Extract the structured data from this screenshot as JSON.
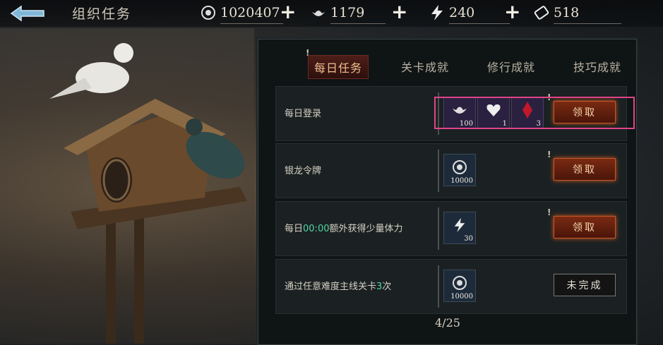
{
  "header": {
    "title": "组织任务",
    "resources": [
      {
        "icon": "coin-icon",
        "value": "1020407"
      },
      {
        "icon": "silver-ingot-icon",
        "value": "1179"
      },
      {
        "icon": "lightning-icon",
        "value": "240"
      },
      {
        "icon": "ticket-icon",
        "value": "518"
      }
    ]
  },
  "tabs": [
    {
      "label": "每日任务",
      "active": true
    },
    {
      "label": "关卡成就",
      "active": false
    },
    {
      "label": "修行成就",
      "active": false
    },
    {
      "label": "技巧成就",
      "active": false
    }
  ],
  "tasks": [
    {
      "name": "每日登录",
      "button": "领取",
      "rewards": [
        {
          "icon": "silver-ingot-icon",
          "qty": "100"
        },
        {
          "icon": "heart-token-icon",
          "qty": "1"
        },
        {
          "icon": "red-crystal-icon",
          "qty": "3"
        }
      ]
    },
    {
      "name": "银龙令牌",
      "button": "领取",
      "rewards": [
        {
          "icon": "coin-icon",
          "qty": "10000"
        }
      ]
    },
    {
      "name_parts": [
        "每日",
        "00:00",
        "额外获得少量体力"
      ],
      "button": "领取",
      "rewards": [
        {
          "icon": "lightning-icon",
          "qty": "30"
        }
      ]
    },
    {
      "name_parts": [
        "通过任意难度主线关卡",
        "3",
        "次"
      ],
      "button": "未完成",
      "rewards": [
        {
          "icon": "coin-icon",
          "qty": "10000"
        }
      ]
    }
  ],
  "pager": "4/25",
  "colors": {
    "highlight": "#e0448a",
    "accent_green": "#4fd7a4",
    "claim_button": "#7a2a12"
  }
}
